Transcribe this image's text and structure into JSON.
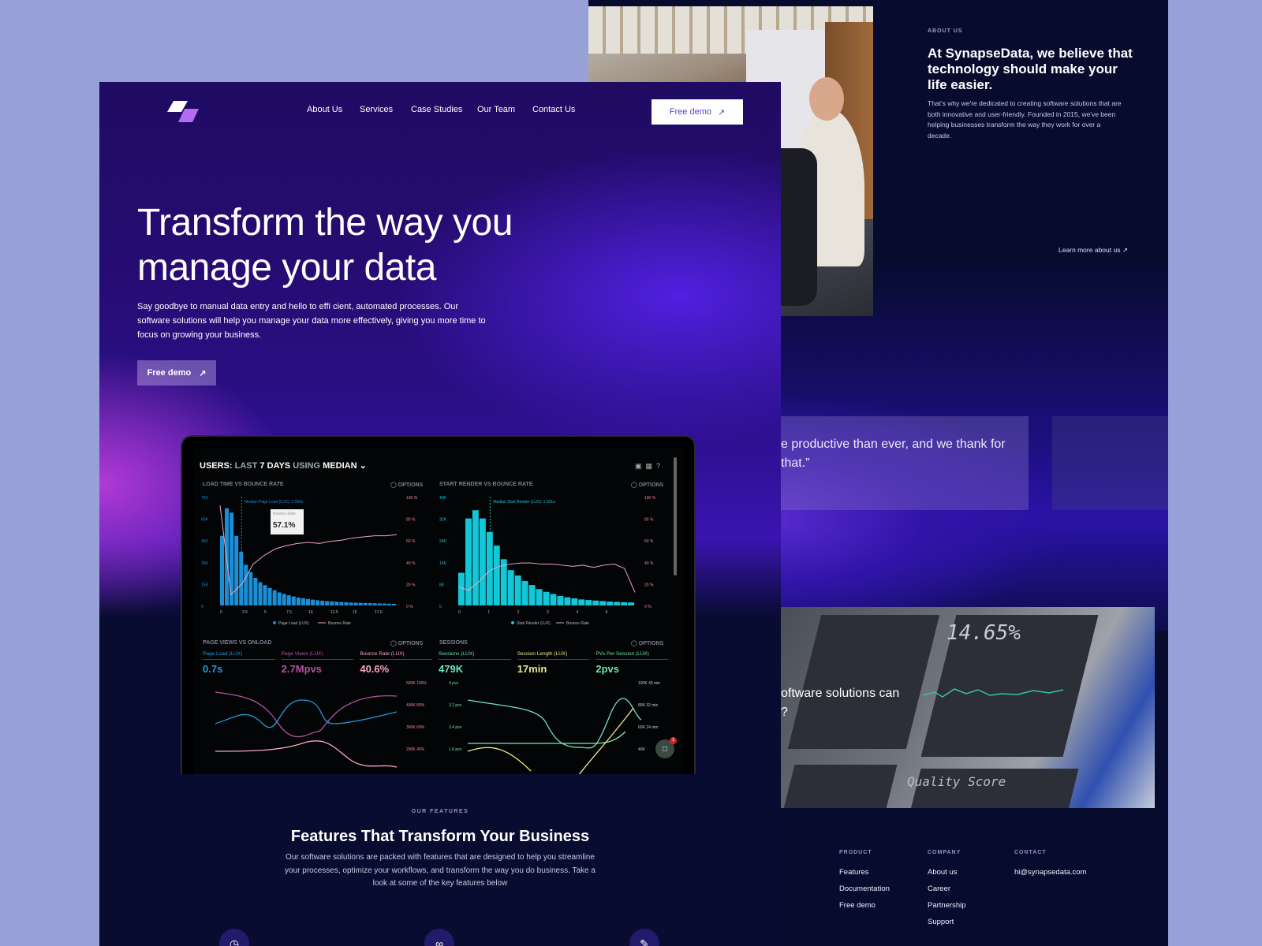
{
  "nav": {
    "items": [
      "About Us",
      "Services",
      "Case Studies",
      "Our Team",
      "Contact Us"
    ],
    "cta": "Free demo",
    "cta_icon": "arrow-up-right-icon"
  },
  "hero": {
    "title": "Transform the way you manage your data",
    "subtitle": "Say goodbye to manual data entry and hello to effi cient, automated processes. Our software solutions will help you manage your data more effectively, giving you more time to focus on growing your business.",
    "cta": "Free demo"
  },
  "dashboard": {
    "header": {
      "prefix": "USERS:",
      "range": "LAST",
      "days": "7 DAYS",
      "using": "USING",
      "mode": "MEDIAN"
    },
    "options": "OPTIONS",
    "panel1": {
      "title": "LOAD TIME VS BOUNCE RATE",
      "median": "Median Page Load (LUX): 2.056s",
      "tooltip_label": "Bounce Rate",
      "tooltip_value": "57.1%",
      "y_left": [
        "75K",
        "60K",
        "45K",
        "30K",
        "15K",
        "0"
      ],
      "y_right": [
        "100 %",
        "80 %",
        "60 %",
        "40 %",
        "20 %",
        "0 %"
      ],
      "x": [
        "0",
        "2.5",
        "5",
        "7.5",
        "10",
        "12.5",
        "15",
        "17.5"
      ],
      "legend": [
        "Page Load (LUX)",
        "Bounce Rate"
      ],
      "bars": [
        48,
        67,
        64,
        48,
        37,
        28,
        23,
        19,
        16,
        14,
        12,
        10.5,
        9,
        8,
        7,
        6.2,
        5.5,
        5,
        4.5,
        4,
        3.6,
        3.3,
        3,
        2.8,
        2.6,
        2.4,
        2.2,
        2,
        1.9,
        1.8,
        1.7,
        1.6,
        1.5,
        1.4,
        1.3,
        1.2,
        1.1
      ],
      "bounce": [
        92,
        10,
        20,
        38,
        46,
        52,
        55,
        57,
        58,
        57,
        59,
        60,
        62,
        63,
        64,
        64,
        65
      ]
    },
    "panel2": {
      "title": "START RENDER VS BOUNCE RATE",
      "median": "Median Start Render (LUX): 1.031s",
      "y_left": [
        "40K",
        "32K",
        "24K",
        "16K",
        "8K",
        "0"
      ],
      "y_right": [
        "100 %",
        "80 %",
        "60 %",
        "40 %",
        "20 %",
        "0 %"
      ],
      "x": [
        "0",
        "1",
        "2",
        "3",
        "4",
        "5"
      ],
      "legend": [
        "Start Render (LUX)",
        "Bounce Rate"
      ],
      "bars": [
        12,
        32,
        35,
        32,
        27,
        22,
        17,
        13,
        11,
        9,
        7.5,
        6,
        5,
        4.2,
        3.5,
        3,
        2.6,
        2.2,
        2,
        1.8,
        1.6,
        1.4,
        1.3,
        1.2,
        1.1
      ],
      "bounce": [
        17,
        14,
        22,
        32,
        36,
        38,
        39,
        39,
        38,
        38,
        37,
        36,
        37,
        35,
        37,
        38,
        34,
        12
      ]
    },
    "panel3": {
      "title": "PAGE VIEWS VS ONLOAD",
      "metrics": [
        {
          "label": "Page Load (LUX)",
          "value": "0.7s",
          "color": "#1e9be0"
        },
        {
          "label": "Page Views (LUX)",
          "value": "2.7Mpvs",
          "color": "#b4559e"
        },
        {
          "label": "Bounce Rate (LUX)",
          "value": "40.6%",
          "color": "#f4a6c0"
        }
      ],
      "y_right": [
        "500K  100%",
        "400K  80%",
        "300K  60%",
        "200K  40%"
      ]
    },
    "panel4": {
      "title": "SESSIONS",
      "metrics": [
        {
          "label": "Sessions (LUX)",
          "value": "479K",
          "color": "#6ee6c0"
        },
        {
          "label": "Session Length (LUX)",
          "value": "17min",
          "color": "#e8ec8a"
        },
        {
          "label": "PVs Per Session (LUX)",
          "value": "2pvs",
          "color": "#6ee6a8"
        }
      ],
      "y_left": [
        "4 pvs",
        "3.2 pvs",
        "2.4 pvs",
        "1.6 pvs"
      ],
      "y_right": [
        "100K  40 min",
        "80K  32 min",
        "60K  24 min",
        "40K"
      ]
    },
    "chat_badge": "1"
  },
  "features": {
    "label": "OUR FEATURES",
    "title": "Features That Transform Your Business",
    "text": "Our software solutions are packed with features that are designed to help you streamline your processes, optimize your workflows, and transform the way you do business. Take a look at some of the key features below",
    "icons": [
      "chart-icon",
      "link-icon",
      "pen-icon"
    ]
  },
  "about": {
    "label": "ABOUT US",
    "title": "At SynapseData, we believe that technology should make your life easier.",
    "text": "That's why we're dedicated to creating software solutions that are both innovative and user-friendly. Founded in 2015, we've been helping businesses transform the way they work for over a decade.",
    "link": "Learn more about us"
  },
  "testimonial": {
    "quote": "e productive than ever, and we thank for that.”"
  },
  "cta_section": {
    "question": "oftware solutions can\n?",
    "screen_texts": [
      "14.65%",
      "Quality Score"
    ]
  },
  "footer": {
    "columns": [
      {
        "heading": "PRODUCT",
        "links": [
          "Features",
          "Documentation",
          "Free demo"
        ]
      },
      {
        "heading": "COMPANY",
        "links": [
          "About us",
          "Career",
          "Partnership",
          "Support"
        ]
      },
      {
        "heading": "CONTACT",
        "links": [
          "hi@synapsedata.com"
        ]
      }
    ]
  },
  "colors": {
    "background": "#98a0d8",
    "page_dark": "#070b2e",
    "hero_purple": "#260c72",
    "accent": "#5b3fd0",
    "logo_purple": "#b46cf0"
  }
}
